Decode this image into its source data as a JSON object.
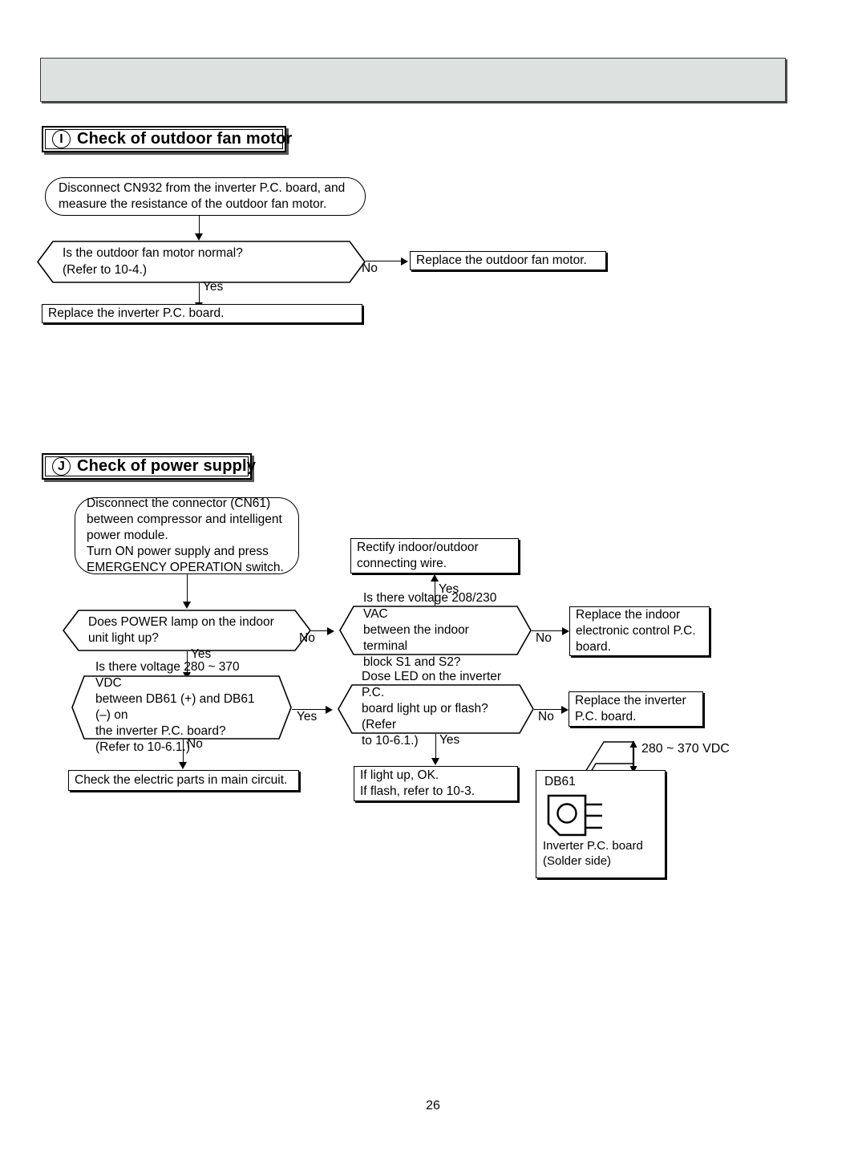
{
  "page": {
    "number": "26",
    "header_banner_color": "#dde2e1"
  },
  "sections": [
    {
      "id": "section-i",
      "marker": "I",
      "title": "Check of outdoor fan motor",
      "nodes": {
        "start": "Disconnect CN932 from the inverter P.C. board, and measure the resistance of the outdoor fan motor.",
        "decision": "Is the outdoor fan motor normal? (Refer to 10-4.)",
        "decision_line1": "Is the outdoor fan motor normal?",
        "decision_line2": "(Refer to 10-4.)",
        "no_target": "Replace the outdoor fan motor.",
        "yes_target": "Replace the inverter P.C. board."
      },
      "branch_labels": {
        "no": "No",
        "yes": "Yes"
      }
    },
    {
      "id": "section-j",
      "marker": "J",
      "title": "Check of power supply",
      "nodes": {
        "start_line1": "Disconnect the connector (CN61)",
        "start_line2": "between compressor and intelligent",
        "start_line3": "power module.",
        "start_line4": "Turn ON power supply and press",
        "start_line5": "EMERGENCY OPERATION switch.",
        "rectify_line1": "Rectify indoor/outdoor",
        "rectify_line2": "connecting wire.",
        "power_lamp_line1": "Does POWER lamp on the indoor",
        "power_lamp_line2": "unit light up?",
        "vac_line1": "Is there voltage 208/230 VAC",
        "vac_line2": "between the indoor terminal",
        "vac_line3": "block S1 and S2?",
        "replace_indoor_line1": "Replace the indoor",
        "replace_indoor_line2": "electronic control P.C.",
        "replace_indoor_line3": "board.",
        "vdc_line1": "Is there voltage 280 ~ 370 VDC",
        "vdc_line2": "between DB61 (+) and DB61 (–) on",
        "vdc_line3": "the inverter P.C. board?",
        "vdc_line4": "(Refer to 10-6.1.)",
        "led_line1": "Dose LED on the inverter P.C.",
        "led_line2": "board light up or flash? (Refer",
        "led_line3": "to 10-6.1.)",
        "replace_inverter_line1": "Replace the inverter",
        "replace_inverter_line2": "P.C. board.",
        "check_parts": "Check the electric parts in main circuit.",
        "light_up_line1": "If light up, OK.",
        "light_up_line2": "If flash, refer to 10-3."
      },
      "branch_labels": {
        "yes_rectify": "Yes",
        "no_power_lamp": "No",
        "yes_power_lamp": "Yes",
        "no_vac": "No",
        "yes_vdc": "Yes",
        "no_vdc": "No",
        "no_led": "No",
        "yes_led": "Yes"
      },
      "illustration": {
        "component_label": "DB61",
        "caption_line1": "Inverter P.C. board",
        "caption_line2": "(Solder side)",
        "dimension_label": "280 ~ 370 VDC"
      }
    }
  ]
}
